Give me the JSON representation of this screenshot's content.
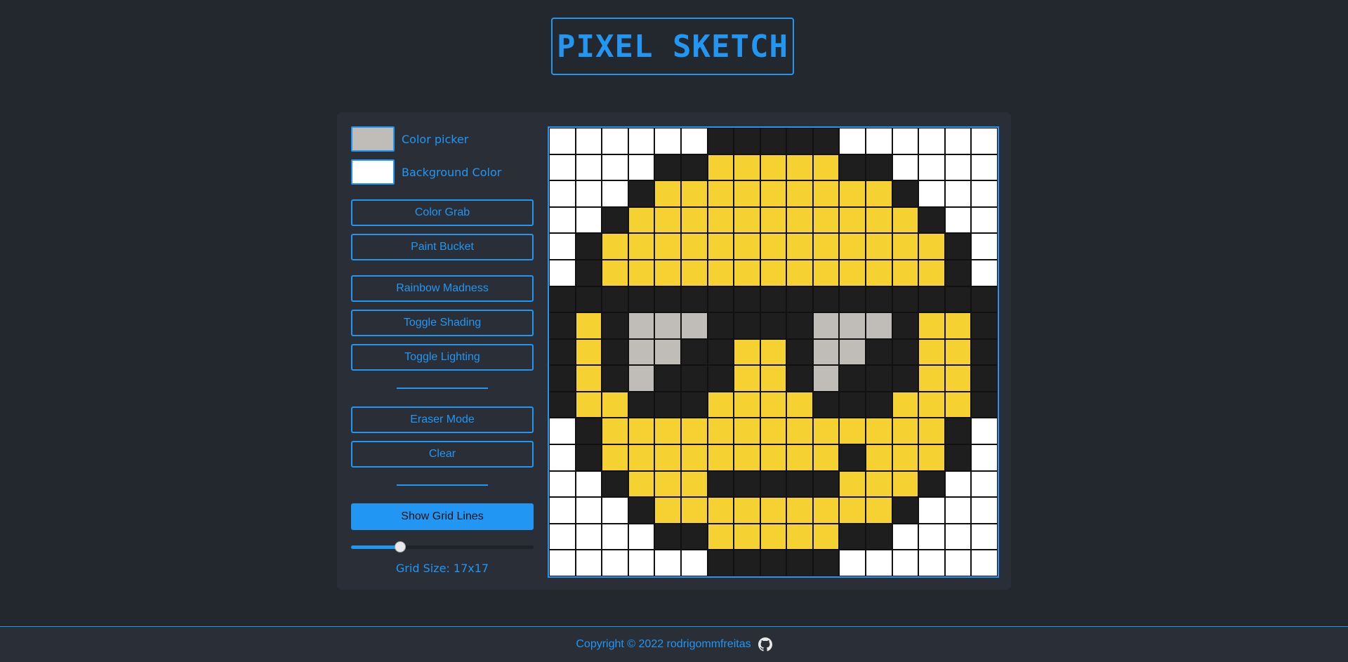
{
  "title": "PIXEL SKETCH",
  "controls": {
    "color_picker_label": "Color picker",
    "color_picker_value": "#c0bdb8",
    "background_color_label": "Background Color",
    "background_color_value": "#ffffff",
    "color_grab": "Color Grab",
    "paint_bucket": "Paint Bucket",
    "rainbow_madness": "Rainbow Madness",
    "toggle_shading": "Toggle Shading",
    "toggle_lighting": "Toggle Lighting",
    "eraser_mode": "Eraser Mode",
    "clear": "Clear",
    "show_grid_lines": "Show Grid Lines",
    "grid_size_label": "Grid Size: 17x17",
    "grid_size_slider": {
      "value": 17,
      "fill_fraction": 0.27
    }
  },
  "canvas": {
    "size": 17,
    "palette": {
      "W": "#ffffff",
      "K": "#1e1e1e",
      "Y": "#f5d132",
      "G": "#c0bdb8"
    },
    "rows": [
      "WWWWWWKKKKKWWWWWW",
      "WWWWKKYYYYYKKWWWW",
      "WWWKYYYYYYYYYKWWW",
      "WWKYYYYYYYYYYYKWW",
      "WKYYYYYYYYYYYYYKW",
      "WKYYYYYYYYYYYYYKW",
      "KKKKKKKKKKKKKKKKK",
      "KYKGGGKKKKGGGKYYK",
      "KYKGGKKYYKGGKKYYK",
      "KYKGKKKYYKGKKKYYK",
      "KYYKKKYYYYKKKYYYK",
      "WKYYYYYYYYYYYYYKW",
      "WKYYYYYYYYYKYYYKW",
      "WWKYYYKKKKKYYYKWW",
      "WWWKYYYYYYYYYKWWW",
      "WWWWKKYYYYYKKWWWW",
      "WWWWWWKKKKKWWWWWW"
    ]
  },
  "footer": {
    "copyright": "Copyright © 2022 rodrigommfreitas",
    "icon": "github-icon"
  }
}
